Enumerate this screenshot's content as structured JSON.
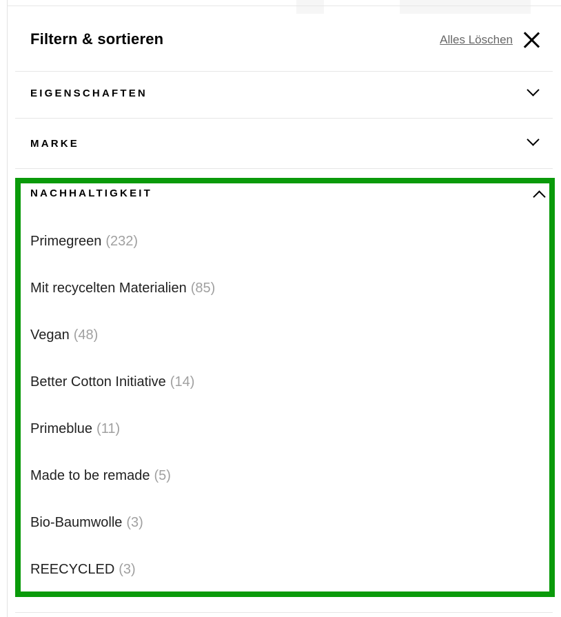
{
  "panel": {
    "title": "Filtern & sortieren",
    "clear_all_label": "Alles Löschen",
    "close_icon": "close-icon"
  },
  "sections": [
    {
      "label": "EIGENSCHAFTEN",
      "expanded": false,
      "icon": "chevron-down-icon"
    },
    {
      "label": "MARKE",
      "expanded": false,
      "icon": "chevron-down-icon"
    },
    {
      "label": "NACHHALTIGKEIT",
      "expanded": true,
      "icon": "chevron-up-icon"
    }
  ],
  "sustainability_options": [
    {
      "label": "Primegreen",
      "count": "(232)"
    },
    {
      "label": "Mit recycelten Materialien",
      "count": "(85)"
    },
    {
      "label": "Vegan",
      "count": "(48)"
    },
    {
      "label": "Better Cotton Initiative",
      "count": "(14)"
    },
    {
      "label": "Primeblue",
      "count": "(11)"
    },
    {
      "label": "Made to be remade",
      "count": "(5)"
    },
    {
      "label": "Bio-Baumwolle",
      "count": "(3)"
    },
    {
      "label": "REECYCLED",
      "count": "(3)"
    }
  ],
  "colors": {
    "highlight": "#0a9a0a",
    "count_text": "#a0a0a0",
    "divider": "#e6e6e6"
  }
}
